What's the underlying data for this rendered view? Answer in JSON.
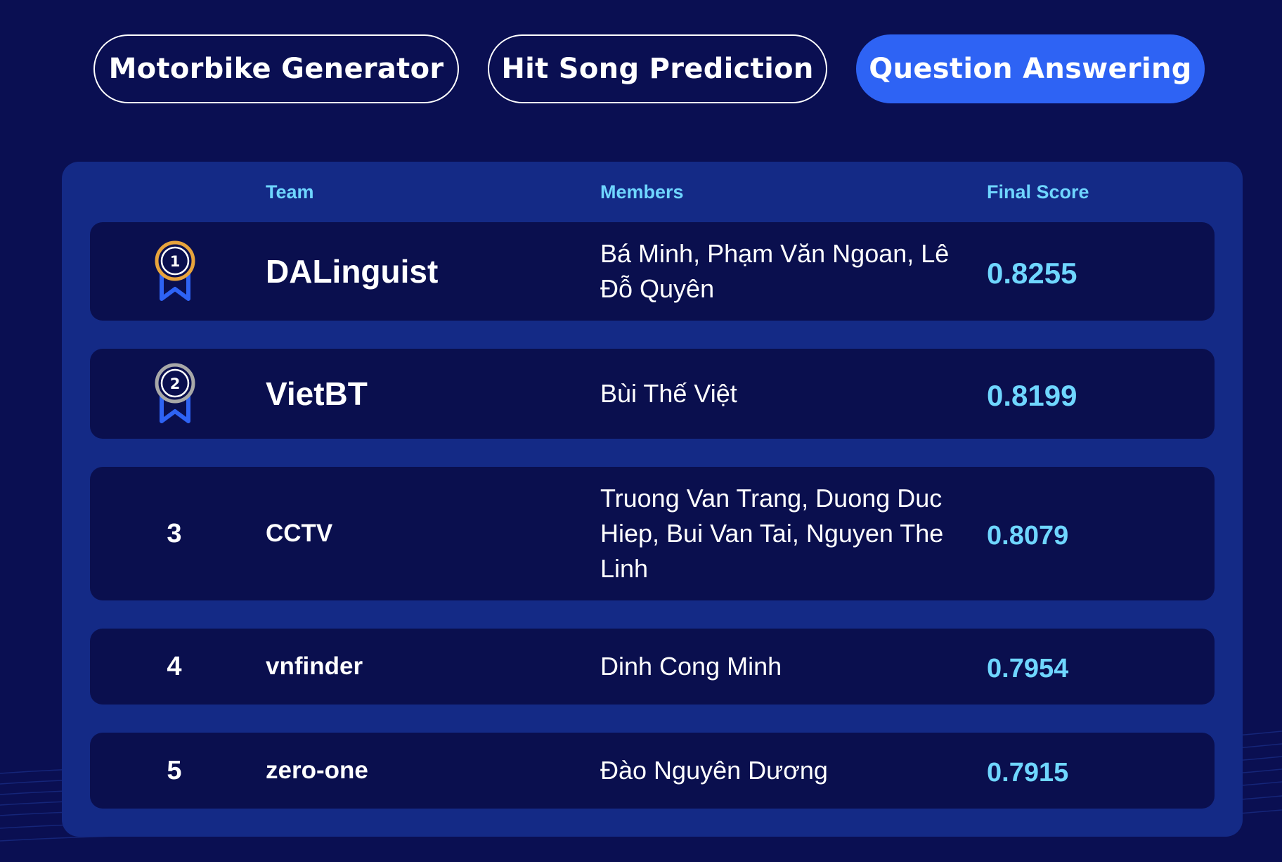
{
  "tabs": [
    {
      "label": "Motorbike Generator",
      "active": false
    },
    {
      "label": "Hit Song Prediction",
      "active": false
    },
    {
      "label": "Question Answering",
      "active": true
    }
  ],
  "table": {
    "headers": {
      "team": "Team",
      "members": "Members",
      "score": "Final Score"
    },
    "rows": [
      {
        "rank": "1",
        "medal": "gold-medal-icon",
        "team": "DALinguist",
        "members": "Bá Minh, Phạm Văn Ngoan, Lê Đỗ Quyên",
        "score": "0.8255"
      },
      {
        "rank": "2",
        "medal": "silver-medal-icon",
        "team": "VietBT",
        "members": "Bùi Thế Việt",
        "score": "0.8199"
      },
      {
        "rank": "3",
        "team": "CCTV",
        "members": "Truong Van Trang, Duong Duc Hiep, Bui Van Tai, Nguyen The Linh",
        "score": "0.8079"
      },
      {
        "rank": "4",
        "team": "vnfinder",
        "members": "Dinh Cong Minh",
        "score": "0.7954"
      },
      {
        "rank": "5",
        "team": "zero-one",
        "members": "Đào Nguyên Dương",
        "score": "0.7915"
      }
    ]
  },
  "colors": {
    "background": "#0a0f52",
    "panel": "#142a86",
    "row": "#0a0f4e",
    "accent": "#2e63f4",
    "score_text": "#6fd6ff",
    "gold": "#e8a43c",
    "silver": "#a8a8a8",
    "ribbon": "#2e63f4"
  }
}
